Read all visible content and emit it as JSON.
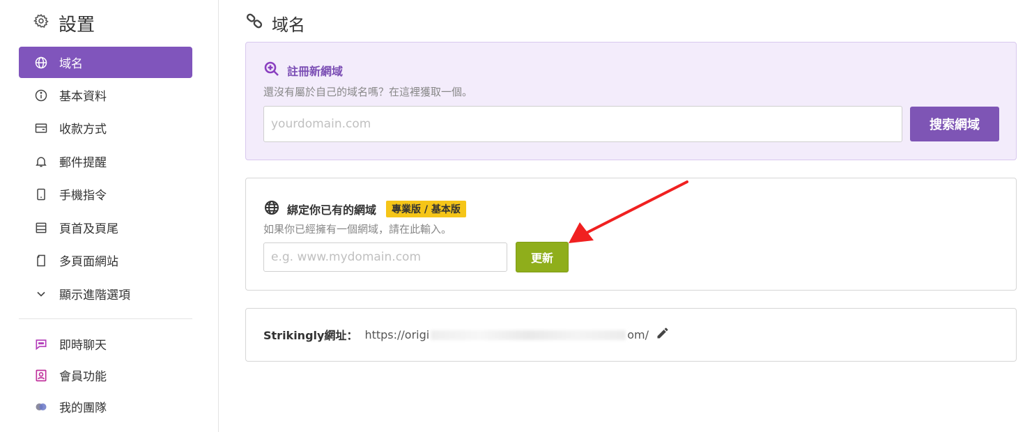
{
  "sidebar": {
    "title": "設置",
    "items": [
      {
        "label": "域名",
        "icon": "globe-icon",
        "active": true
      },
      {
        "label": "基本資料",
        "icon": "info-icon"
      },
      {
        "label": "收款方式",
        "icon": "wallet-icon"
      },
      {
        "label": "郵件提醒",
        "icon": "bell-icon"
      },
      {
        "label": "手機指令",
        "icon": "phone-icon"
      },
      {
        "label": "頁首及頁尾",
        "icon": "layout-icon"
      },
      {
        "label": "多頁面網站",
        "icon": "pages-icon"
      },
      {
        "label": "顯示進階選項",
        "icon": "chevron-down-icon"
      }
    ],
    "extras": [
      {
        "label": "即時聊天",
        "icon": "chat-icon"
      },
      {
        "label": "會員功能",
        "icon": "member-icon"
      },
      {
        "label": "我的團隊",
        "icon": "team-icon"
      }
    ]
  },
  "header": {
    "title": "域名"
  },
  "register": {
    "title": "註冊新網域",
    "description": "還沒有屬於自己的域名嗎？在這裡獲取一個。",
    "placeholder": "yourdomain.com",
    "button": "搜索網域"
  },
  "bind": {
    "title": "綁定你已有的網域",
    "badge": "專業版 / 基本版",
    "description": "如果你已經擁有一個網域，請在此輸入。",
    "placeholder": "e.g. www.mydomain.com",
    "button": "更新"
  },
  "strikingly": {
    "label": "Strikingly網址：",
    "url_prefix": "https://origi",
    "url_suffix": "om/"
  },
  "colors": {
    "accent": "#8055bc",
    "update_button": "#8fae1b",
    "badge": "#f5c518",
    "arrow": "#f02020"
  }
}
